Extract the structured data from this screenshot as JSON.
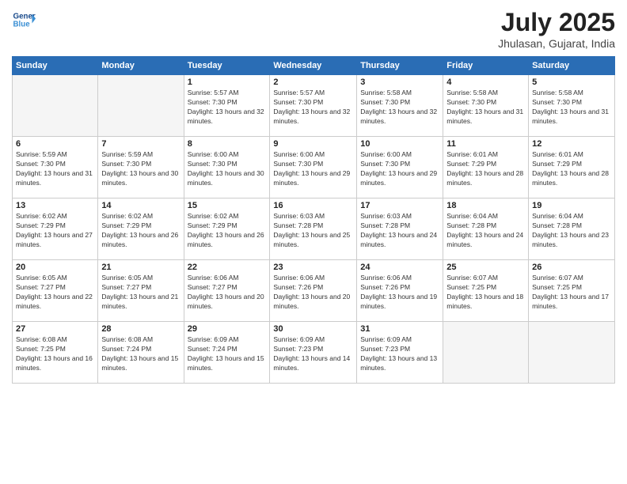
{
  "header": {
    "logo_line1": "General",
    "logo_line2": "Blue",
    "month": "July 2025",
    "location": "Jhulasan, Gujarat, India"
  },
  "weekdays": [
    "Sunday",
    "Monday",
    "Tuesday",
    "Wednesday",
    "Thursday",
    "Friday",
    "Saturday"
  ],
  "weeks": [
    [
      {
        "day": "",
        "info": ""
      },
      {
        "day": "",
        "info": ""
      },
      {
        "day": "1",
        "info": "Sunrise: 5:57 AM\nSunset: 7:30 PM\nDaylight: 13 hours and 32 minutes."
      },
      {
        "day": "2",
        "info": "Sunrise: 5:57 AM\nSunset: 7:30 PM\nDaylight: 13 hours and 32 minutes."
      },
      {
        "day": "3",
        "info": "Sunrise: 5:58 AM\nSunset: 7:30 PM\nDaylight: 13 hours and 32 minutes."
      },
      {
        "day": "4",
        "info": "Sunrise: 5:58 AM\nSunset: 7:30 PM\nDaylight: 13 hours and 31 minutes."
      },
      {
        "day": "5",
        "info": "Sunrise: 5:58 AM\nSunset: 7:30 PM\nDaylight: 13 hours and 31 minutes."
      }
    ],
    [
      {
        "day": "6",
        "info": "Sunrise: 5:59 AM\nSunset: 7:30 PM\nDaylight: 13 hours and 31 minutes."
      },
      {
        "day": "7",
        "info": "Sunrise: 5:59 AM\nSunset: 7:30 PM\nDaylight: 13 hours and 30 minutes."
      },
      {
        "day": "8",
        "info": "Sunrise: 6:00 AM\nSunset: 7:30 PM\nDaylight: 13 hours and 30 minutes."
      },
      {
        "day": "9",
        "info": "Sunrise: 6:00 AM\nSunset: 7:30 PM\nDaylight: 13 hours and 29 minutes."
      },
      {
        "day": "10",
        "info": "Sunrise: 6:00 AM\nSunset: 7:30 PM\nDaylight: 13 hours and 29 minutes."
      },
      {
        "day": "11",
        "info": "Sunrise: 6:01 AM\nSunset: 7:29 PM\nDaylight: 13 hours and 28 minutes."
      },
      {
        "day": "12",
        "info": "Sunrise: 6:01 AM\nSunset: 7:29 PM\nDaylight: 13 hours and 28 minutes."
      }
    ],
    [
      {
        "day": "13",
        "info": "Sunrise: 6:02 AM\nSunset: 7:29 PM\nDaylight: 13 hours and 27 minutes."
      },
      {
        "day": "14",
        "info": "Sunrise: 6:02 AM\nSunset: 7:29 PM\nDaylight: 13 hours and 26 minutes."
      },
      {
        "day": "15",
        "info": "Sunrise: 6:02 AM\nSunset: 7:29 PM\nDaylight: 13 hours and 26 minutes."
      },
      {
        "day": "16",
        "info": "Sunrise: 6:03 AM\nSunset: 7:28 PM\nDaylight: 13 hours and 25 minutes."
      },
      {
        "day": "17",
        "info": "Sunrise: 6:03 AM\nSunset: 7:28 PM\nDaylight: 13 hours and 24 minutes."
      },
      {
        "day": "18",
        "info": "Sunrise: 6:04 AM\nSunset: 7:28 PM\nDaylight: 13 hours and 24 minutes."
      },
      {
        "day": "19",
        "info": "Sunrise: 6:04 AM\nSunset: 7:28 PM\nDaylight: 13 hours and 23 minutes."
      }
    ],
    [
      {
        "day": "20",
        "info": "Sunrise: 6:05 AM\nSunset: 7:27 PM\nDaylight: 13 hours and 22 minutes."
      },
      {
        "day": "21",
        "info": "Sunrise: 6:05 AM\nSunset: 7:27 PM\nDaylight: 13 hours and 21 minutes."
      },
      {
        "day": "22",
        "info": "Sunrise: 6:06 AM\nSunset: 7:27 PM\nDaylight: 13 hours and 20 minutes."
      },
      {
        "day": "23",
        "info": "Sunrise: 6:06 AM\nSunset: 7:26 PM\nDaylight: 13 hours and 20 minutes."
      },
      {
        "day": "24",
        "info": "Sunrise: 6:06 AM\nSunset: 7:26 PM\nDaylight: 13 hours and 19 minutes."
      },
      {
        "day": "25",
        "info": "Sunrise: 6:07 AM\nSunset: 7:25 PM\nDaylight: 13 hours and 18 minutes."
      },
      {
        "day": "26",
        "info": "Sunrise: 6:07 AM\nSunset: 7:25 PM\nDaylight: 13 hours and 17 minutes."
      }
    ],
    [
      {
        "day": "27",
        "info": "Sunrise: 6:08 AM\nSunset: 7:25 PM\nDaylight: 13 hours and 16 minutes."
      },
      {
        "day": "28",
        "info": "Sunrise: 6:08 AM\nSunset: 7:24 PM\nDaylight: 13 hours and 15 minutes."
      },
      {
        "day": "29",
        "info": "Sunrise: 6:09 AM\nSunset: 7:24 PM\nDaylight: 13 hours and 15 minutes."
      },
      {
        "day": "30",
        "info": "Sunrise: 6:09 AM\nSunset: 7:23 PM\nDaylight: 13 hours and 14 minutes."
      },
      {
        "day": "31",
        "info": "Sunrise: 6:09 AM\nSunset: 7:23 PM\nDaylight: 13 hours and 13 minutes."
      },
      {
        "day": "",
        "info": ""
      },
      {
        "day": "",
        "info": ""
      }
    ]
  ]
}
